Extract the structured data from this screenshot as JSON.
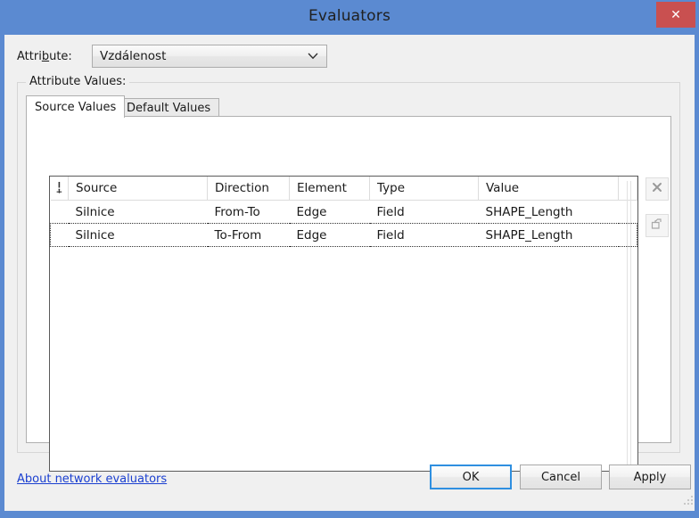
{
  "window": {
    "title": "Evaluators",
    "close_label": "✕",
    "titlebar_color": "#5b8ad1",
    "close_color": "#c95050"
  },
  "attribute": {
    "label_prefix": "Attri",
    "label_accel": "b",
    "label_suffix": "ute:",
    "selected_value": "Vzdálenost",
    "dropdown_icon": "chevron-down-icon"
  },
  "group": {
    "legend": "Attribute Values:"
  },
  "tabs": [
    {
      "label": "Source Values",
      "active": true
    },
    {
      "label": "Default Values",
      "active": false
    }
  ],
  "table": {
    "sort_icon": "sort-indicator-icon",
    "columns": [
      "Source",
      "Direction",
      "Element",
      "Type",
      "Value"
    ],
    "rows": [
      {
        "source": "Silnice",
        "direction": "From-To",
        "element": "Edge",
        "type": "Field",
        "value": "SHAPE_Length",
        "focused": false
      },
      {
        "source": "Silnice",
        "direction": "To-From",
        "element": "Edge",
        "type": "Field",
        "value": "SHAPE_Length",
        "focused": true
      }
    ]
  },
  "side_buttons": [
    {
      "name": "delete-evaluator-button",
      "icon": "close-x-icon",
      "enabled": false
    },
    {
      "name": "properties-button",
      "icon": "paint-bucket-icon",
      "enabled": false
    }
  ],
  "footer": {
    "link": "About network evaluators",
    "ok": "OK",
    "cancel": "Cancel",
    "apply": "Apply",
    "link_color": "#1a3fd0",
    "default_button_border": "#2e8fe0"
  }
}
